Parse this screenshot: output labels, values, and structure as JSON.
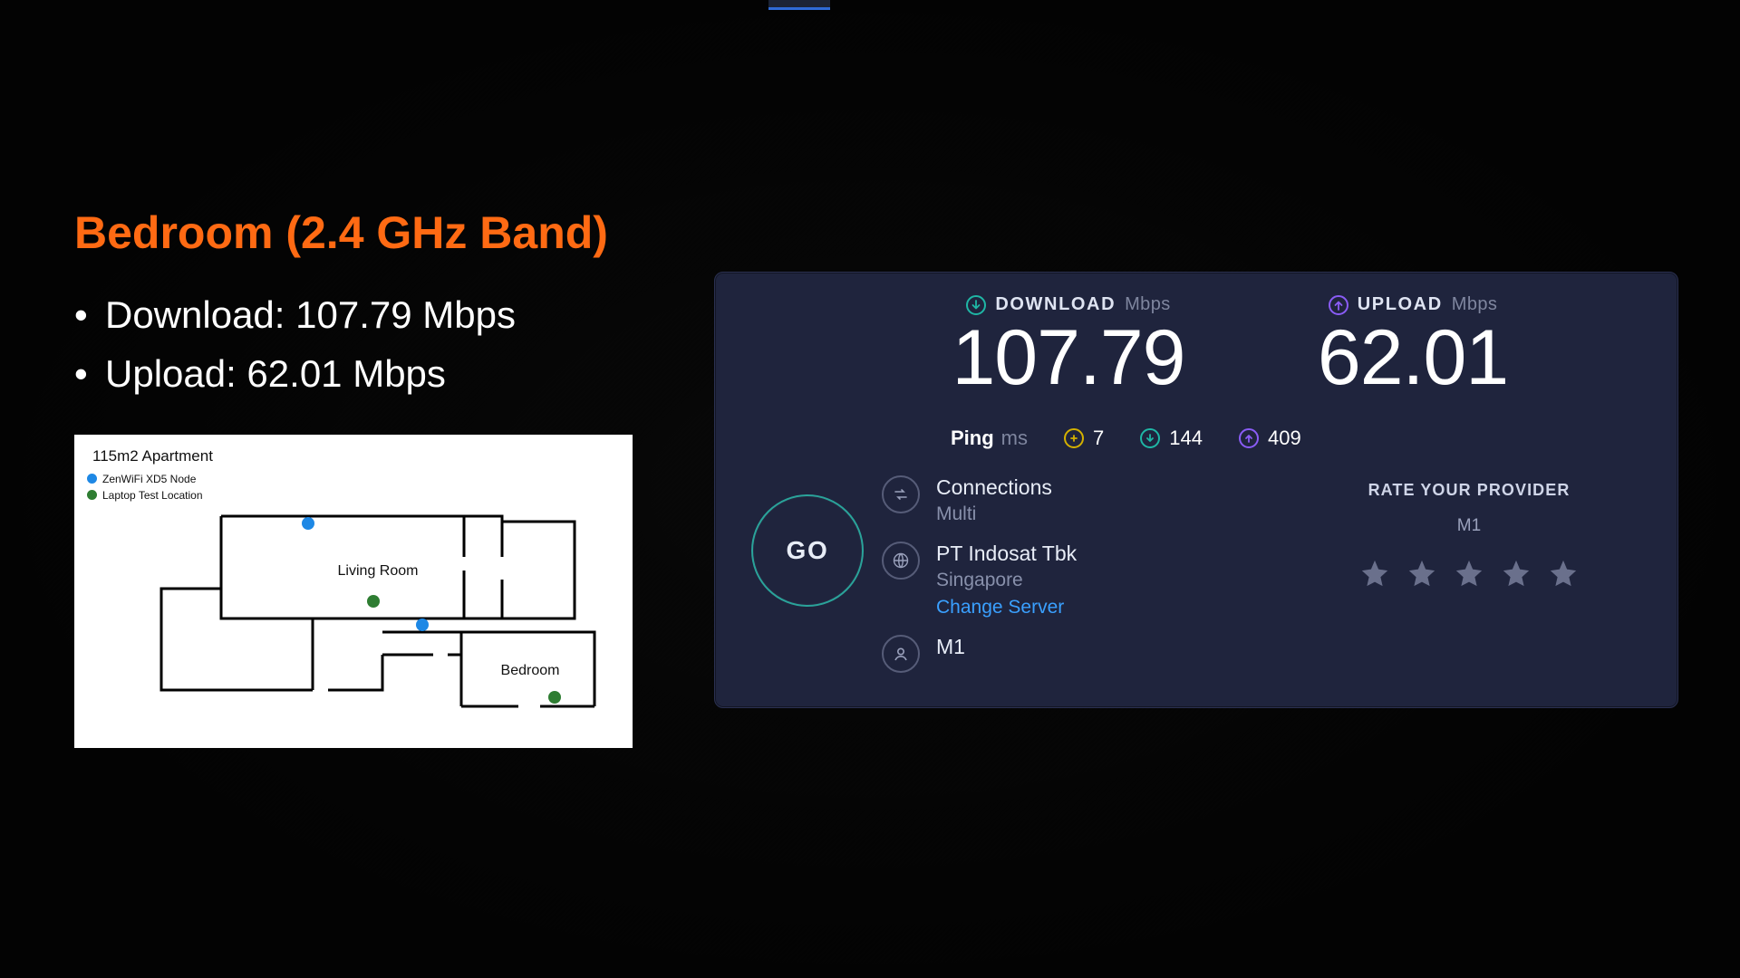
{
  "slide": {
    "title": "Bedroom (2.4 GHz Band)",
    "download_line": "Download: 107.79 Mbps",
    "upload_line": "Upload: 62.01 Mbps"
  },
  "floorplan": {
    "title": "115m2 Apartment",
    "legend": {
      "node": "ZenWiFi XD5 Node",
      "laptop": "Laptop Test Location"
    },
    "room_living": "Living Room",
    "room_bedroom": "Bedroom"
  },
  "speedtest": {
    "download": {
      "label": "DOWNLOAD",
      "unit": "Mbps",
      "value": "107.79"
    },
    "upload": {
      "label": "UPLOAD",
      "unit": "Mbps",
      "value": "62.01"
    },
    "ping": {
      "label": "Ping",
      "unit": "ms",
      "idle": "7",
      "down": "144",
      "up": "409"
    },
    "go": "GO",
    "connections": {
      "title": "Connections",
      "value": "Multi"
    },
    "server": {
      "title": "PT Indosat Tbk",
      "location": "Singapore",
      "change": "Change Server"
    },
    "isp": {
      "title": "M1"
    },
    "rate": {
      "title": "RATE YOUR PROVIDER",
      "name": "M1"
    }
  }
}
